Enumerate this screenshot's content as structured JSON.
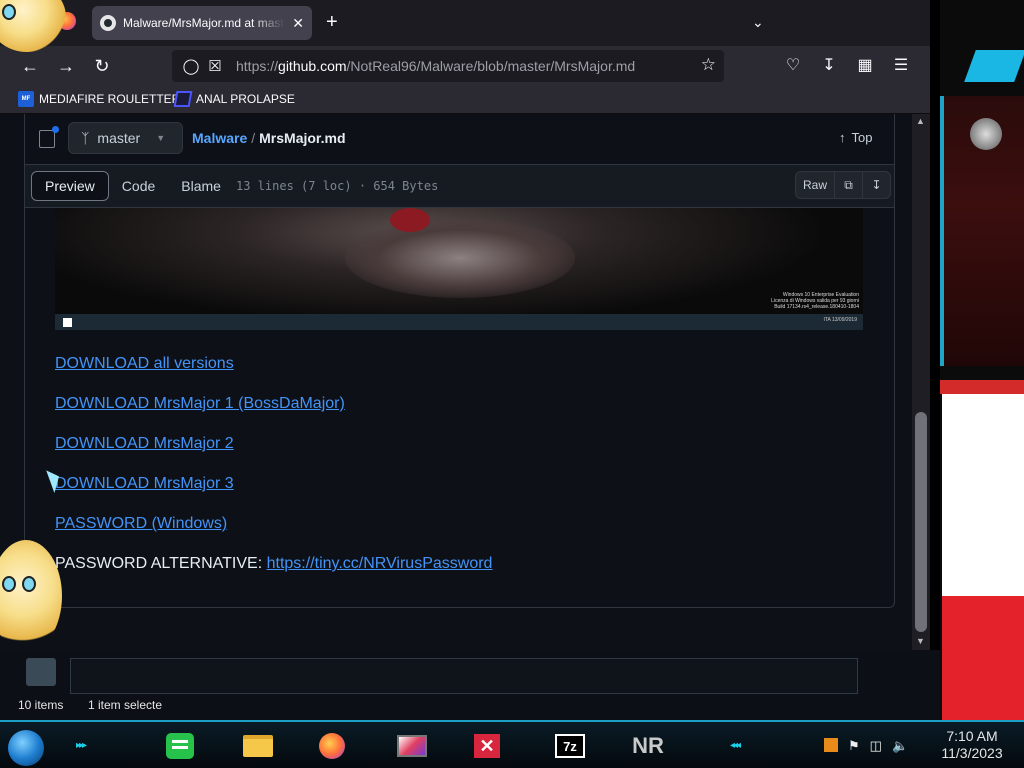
{
  "browser": {
    "tab_title": "Malware/MrsMajor.md at master",
    "new_tab": "+",
    "tab_close": "✕",
    "url_scheme": "https://",
    "url_host": "github.com",
    "url_path": "/NotReal96/Malware/blob/master/MrsMajor.md"
  },
  "bookmarks": [
    {
      "label": "MEDIAFIRE ROULETTER",
      "icon": "mediafire-icon"
    },
    {
      "label": "ANAL PROLAPSE",
      "icon": "bookmark-triangle-icon"
    }
  ],
  "github": {
    "branch": "master",
    "repo": "Malware",
    "separator": "/",
    "file": "MrsMajor.md",
    "top_label": "Top",
    "view_tabs": [
      {
        "label": "Preview",
        "active": true
      },
      {
        "label": "Code",
        "active": false
      },
      {
        "label": "Blame",
        "active": false
      }
    ],
    "meta": "13 lines (7 loc) · 654 Bytes",
    "raw_label": "Raw"
  },
  "embedded_screenshot": {
    "caption_lines": [
      "Windows 10 Enterprise Evaluation",
      "Licenza di Windows valida per 93 giorni",
      "Build 17134.rs4_release.180410-1804"
    ],
    "tray_text": "ITA  13/09/2019"
  },
  "content": {
    "links": [
      "DOWNLOAD all versions",
      "DOWNLOAD MrsMajor 1 (BossDaMajor)",
      "DOWNLOAD MrsMajor 2",
      "DOWNLOAD MrsMajor 3",
      "PASSWORD (Windows)"
    ],
    "password_alt_label": "PASSWORD ALTERNATIVE: ",
    "password_alt_link": "https://tiny.cc/NRVirusPassword"
  },
  "file_manager": {
    "item_count": "10 items",
    "selection": "1 item selecte"
  },
  "taskbar": {
    "nr_label": "NR",
    "sevenzip_label": "7z",
    "close_label": "✕",
    "time": "7:10 AM",
    "date": "11/3/2023"
  },
  "colors": {
    "link": "#4493f8",
    "page_bg": "#0d1117",
    "accent_cyan": "#1b9fc4"
  }
}
